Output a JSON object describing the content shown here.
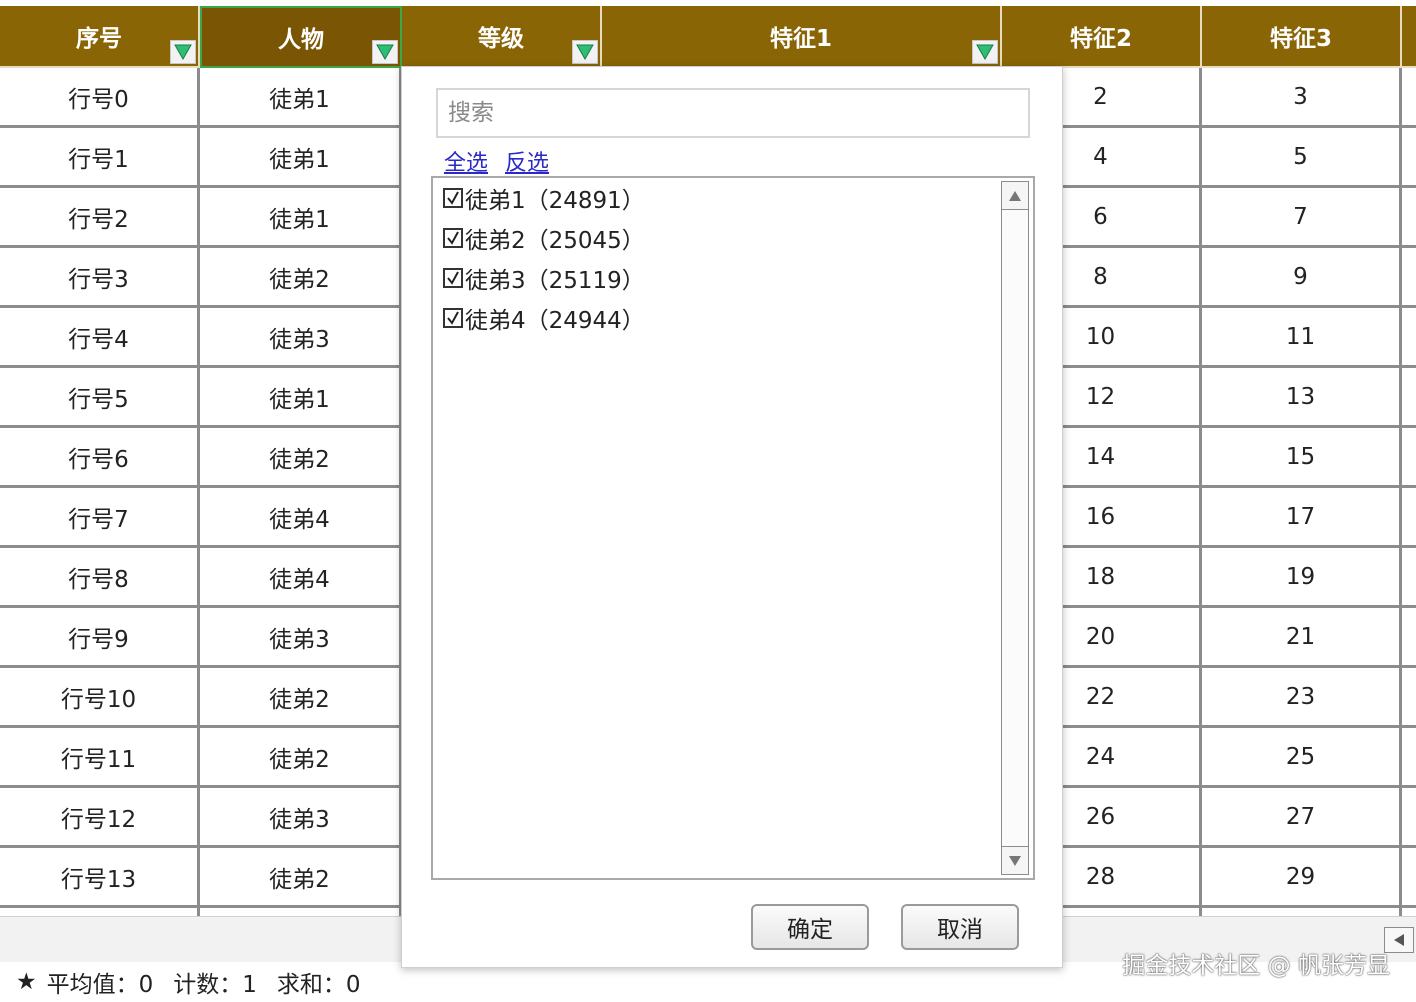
{
  "colors": {
    "header_bg": "#8a6506",
    "header_text": "#ffffff",
    "grid_line": "#8c8c8c",
    "filter_arrow": "#2bbf73",
    "link": "#2a2ac9"
  },
  "columns": [
    {
      "label": "序号",
      "filter": true
    },
    {
      "label": "人物",
      "filter": true,
      "active": true
    },
    {
      "label": "等级",
      "filter": true
    },
    {
      "label": "特征1",
      "filter": true
    },
    {
      "label": "特征2",
      "filter": false
    },
    {
      "label": "特征3",
      "filter": false
    }
  ],
  "rows": [
    [
      "行号0",
      "徒弟1",
      "",
      "",
      "2",
      "3"
    ],
    [
      "行号1",
      "徒弟1",
      "",
      "",
      "4",
      "5"
    ],
    [
      "行号2",
      "徒弟1",
      "",
      "",
      "6",
      "7"
    ],
    [
      "行号3",
      "徒弟2",
      "",
      "",
      "8",
      "9"
    ],
    [
      "行号4",
      "徒弟3",
      "",
      "",
      "10",
      "11"
    ],
    [
      "行号5",
      "徒弟1",
      "",
      "",
      "12",
      "13"
    ],
    [
      "行号6",
      "徒弟2",
      "",
      "",
      "14",
      "15"
    ],
    [
      "行号7",
      "徒弟4",
      "",
      "",
      "16",
      "17"
    ],
    [
      "行号8",
      "徒弟4",
      "",
      "",
      "18",
      "19"
    ],
    [
      "行号9",
      "徒弟3",
      "",
      "",
      "20",
      "21"
    ],
    [
      "行号10",
      "徒弟2",
      "",
      "",
      "22",
      "23"
    ],
    [
      "行号11",
      "徒弟2",
      "",
      "",
      "24",
      "25"
    ],
    [
      "行号12",
      "徒弟3",
      "",
      "",
      "26",
      "27"
    ],
    [
      "行号13",
      "徒弟2",
      "",
      "",
      "28",
      "29"
    ]
  ],
  "filter_popup": {
    "search_placeholder": "搜索",
    "select_all": "全选",
    "invert": "反选",
    "items": [
      {
        "label": "徒弟1（24891）",
        "checked": true
      },
      {
        "label": "徒弟2（25045）",
        "checked": true
      },
      {
        "label": "徒弟3（25119）",
        "checked": true
      },
      {
        "label": "徒弟4（24944）",
        "checked": true
      }
    ],
    "ok": "确定",
    "cancel": "取消"
  },
  "status_bar": {
    "star": "★",
    "average": "平均值：0",
    "count": "计数：1",
    "sum": "求和：0"
  },
  "watermark": "掘金技术社区 @ 帆张芳显"
}
